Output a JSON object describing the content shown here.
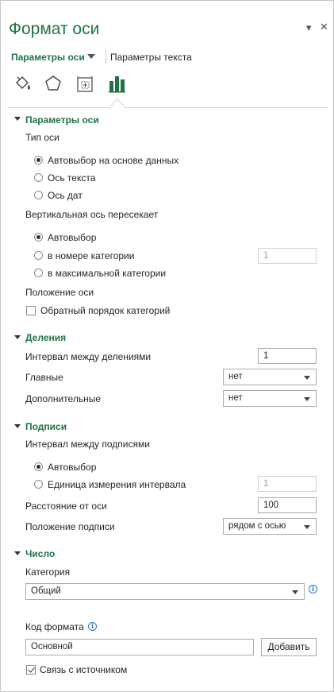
{
  "header": {
    "title": "Формат оси",
    "dropdown_glyph": "▾",
    "close_glyph": "✕"
  },
  "tabs": {
    "main": "Параметры оси",
    "text": "Параметры текста"
  },
  "icons": [
    "fill-line-icon",
    "effects-pentagon-icon",
    "size-properties-icon",
    "axis-options-bar-chart-icon"
  ],
  "colors": {
    "accent": "#217346",
    "info": "#2e75b6"
  },
  "axis_options": {
    "heading": "Параметры оси",
    "axis_type": {
      "label": "Тип оси",
      "options": [
        {
          "label": "Автовыбор на основе данных",
          "selected": true
        },
        {
          "label": "Ось текста",
          "selected": false
        },
        {
          "label": "Ось дат",
          "selected": false
        }
      ]
    },
    "crosses": {
      "label": "Вертикальная ось пересекает",
      "options": [
        {
          "label": "Автовыбор",
          "selected": true
        },
        {
          "label": "в номере категории",
          "selected": false
        },
        {
          "label": "в максимальной категории",
          "selected": false
        }
      ],
      "category_number": "1"
    },
    "position": {
      "label": "Положение оси",
      "reverse_label": "Обратный порядок категорий",
      "reverse_checked": false
    }
  },
  "ticks": {
    "heading": "Деления",
    "interval_label": "Интервал между делениями",
    "interval_value": "1",
    "major_label": "Главные",
    "major_value": "нет",
    "minor_label": "Дополнительные",
    "minor_value": "нет"
  },
  "labels": {
    "heading": "Подписи",
    "interval_label": "Интервал между подписями",
    "options": [
      {
        "label": "Автовыбор",
        "selected": true
      },
      {
        "label": "Единица измерения интервала",
        "selected": false
      }
    ],
    "unit_value": "1",
    "distance_label": "Расстояние от оси",
    "distance_value": "100",
    "position_label": "Положение подписи",
    "position_value": "рядом с осью"
  },
  "number": {
    "heading": "Число",
    "category_label": "Категория",
    "category_value": "Общий",
    "format_code_label": "Код формата",
    "format_code_value": "Основной",
    "add_button": "Добавить",
    "link_label": "Связь с источником",
    "link_checked": true
  }
}
